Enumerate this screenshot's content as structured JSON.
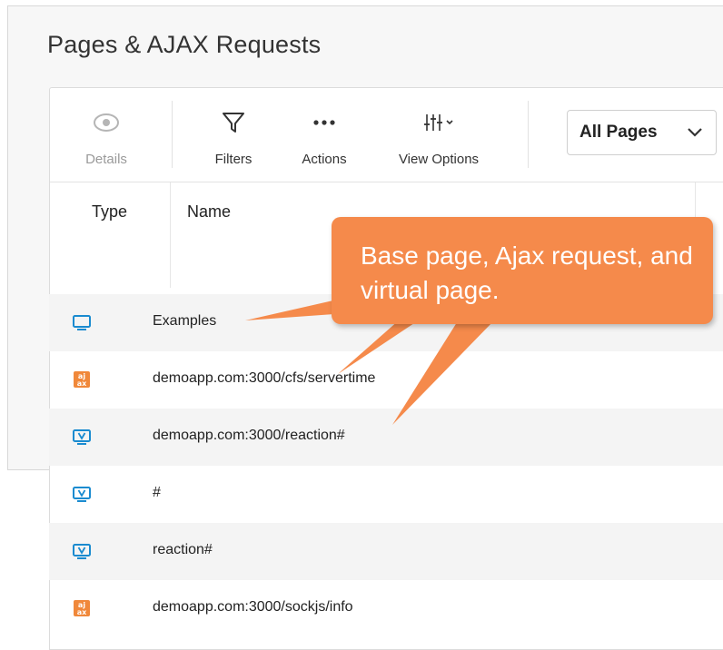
{
  "page": {
    "title": "Pages & AJAX Requests"
  },
  "toolbar": {
    "details_label": "Details",
    "filters_label": "Filters",
    "actions_label": "Actions",
    "view_options_label": "View Options",
    "view_select_value": "All Pages"
  },
  "columns": {
    "type": "Type",
    "name": "Name"
  },
  "rows": [
    {
      "type": "base-page",
      "name": "Examples"
    },
    {
      "type": "ajax-request",
      "name": "demoapp.com:3000/cfs/servertime"
    },
    {
      "type": "virtual-page",
      "name": "demoapp.com:3000/reaction#"
    },
    {
      "type": "virtual-page",
      "name": "#"
    },
    {
      "type": "virtual-page",
      "name": "reaction#"
    },
    {
      "type": "ajax-request",
      "name": "demoapp.com:3000/sockjs/info"
    }
  ],
  "callout": {
    "text": "Base page, Ajax request, and virtual page."
  },
  "colors": {
    "accent_blue": "#1a8bd0",
    "ajax_orange": "#f0883a",
    "callout_orange": "#f58a4b",
    "row_shade": "#f4f4f4"
  },
  "icons": {
    "details": "eye-icon",
    "filters": "funnel-icon",
    "actions": "ellipsis-icon",
    "view_options": "sliders-icon",
    "select": "chevron-down-icon",
    "base_page": "monitor-icon",
    "ajax_request": "ajax-icon",
    "virtual_page": "virtual-page-icon"
  }
}
